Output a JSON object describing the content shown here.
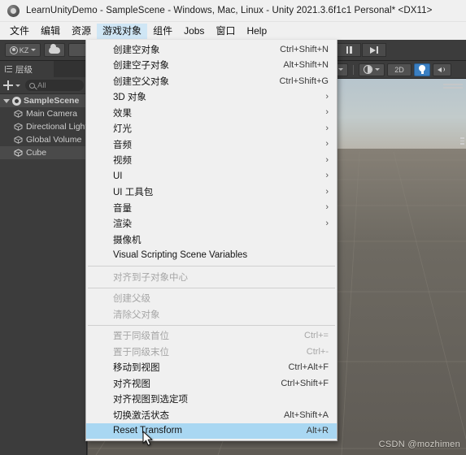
{
  "window": {
    "title": "LearnUnityDemo - SampleScene - Windows, Mac, Linux - Unity 2021.3.6f1c1 Personal* <DX11>",
    "icon": "unity-logo-icon"
  },
  "menubar": {
    "items": [
      {
        "label": "文件",
        "active": false
      },
      {
        "label": "编辑",
        "active": false
      },
      {
        "label": "资源",
        "active": false
      },
      {
        "label": "游戏对象",
        "active": true
      },
      {
        "label": "组件",
        "active": false
      },
      {
        "label": "Jobs",
        "active": false
      },
      {
        "label": "窗口",
        "active": false
      },
      {
        "label": "Help",
        "active": false
      }
    ]
  },
  "toolbar": {
    "account_label": "KZ",
    "account_icon": "user-avatar-icon",
    "cloud_icon": "cloud-icon",
    "pause_icon": "pause-icon",
    "step_icon": "step-forward-icon"
  },
  "hierarchy": {
    "tab_label": "层级",
    "tab_icon": "hierarchy-icon",
    "add_icon": "plus-icon",
    "search_icon": "search-icon",
    "search_placeholder": "All",
    "search_value": "",
    "items": [
      {
        "label": "SampleScene",
        "depth": 0,
        "icon": "scene-icon",
        "expanded": true,
        "selected": false
      },
      {
        "label": "Main Camera",
        "depth": 1,
        "icon": "cube-icon",
        "selected": false
      },
      {
        "label": "Directional Light",
        "depth": 1,
        "icon": "cube-icon",
        "selected": false
      },
      {
        "label": "Global Volume",
        "depth": 1,
        "icon": "cube-icon",
        "selected": false
      },
      {
        "label": "Cube",
        "depth": 1,
        "icon": "cube-icon",
        "selected": true
      }
    ]
  },
  "scene_toolbar": {
    "dropdown_icon": "chevron-down-icon",
    "shading_icon": "shading-mode-icon",
    "shading_caret_icon": "chevron-down-icon",
    "two_d_label": "2D",
    "lighting_icon": "lightbulb-icon",
    "audio_icon": "audio-icon"
  },
  "scene": {
    "sun_gizmo_icon": "directional-light-gizmo-icon",
    "selected_object_outline_color": "#ff7a1a",
    "axis_y_color": "#5ef23c",
    "axis_z_color": "#2158f0",
    "axis_x_color": "#f02b2b",
    "watermark": "CSDN @mozhimen"
  },
  "dropdown_menu": {
    "name": "游戏对象",
    "items": [
      {
        "label": "创建空对象",
        "shortcut": "Ctrl+Shift+N",
        "submenu": false,
        "enabled": true,
        "selected": false
      },
      {
        "label": "创建空子对象",
        "shortcut": "Alt+Shift+N",
        "submenu": false,
        "enabled": true,
        "selected": false
      },
      {
        "label": "创建空父对象",
        "shortcut": "Ctrl+Shift+G",
        "submenu": false,
        "enabled": true,
        "selected": false
      },
      {
        "label": "3D 对象",
        "shortcut": "",
        "submenu": true,
        "enabled": true,
        "selected": false
      },
      {
        "label": "效果",
        "shortcut": "",
        "submenu": true,
        "enabled": true,
        "selected": false
      },
      {
        "label": "灯光",
        "shortcut": "",
        "submenu": true,
        "enabled": true,
        "selected": false
      },
      {
        "label": "音频",
        "shortcut": "",
        "submenu": true,
        "enabled": true,
        "selected": false
      },
      {
        "label": "视频",
        "shortcut": "",
        "submenu": true,
        "enabled": true,
        "selected": false
      },
      {
        "label": "UI",
        "shortcut": "",
        "submenu": true,
        "enabled": true,
        "selected": false
      },
      {
        "label": "UI 工具包",
        "shortcut": "",
        "submenu": true,
        "enabled": true,
        "selected": false
      },
      {
        "label": "音量",
        "shortcut": "",
        "submenu": true,
        "enabled": true,
        "selected": false
      },
      {
        "label": "渲染",
        "shortcut": "",
        "submenu": true,
        "enabled": true,
        "selected": false
      },
      {
        "label": "摄像机",
        "shortcut": "",
        "submenu": false,
        "enabled": true,
        "selected": false
      },
      {
        "label": "Visual Scripting Scene Variables",
        "shortcut": "",
        "submenu": false,
        "enabled": true,
        "selected": false
      },
      {
        "separator": true
      },
      {
        "label": "对齐到子对象中心",
        "shortcut": "",
        "submenu": false,
        "enabled": false,
        "selected": false
      },
      {
        "separator": true
      },
      {
        "label": "创建父级",
        "shortcut": "",
        "submenu": false,
        "enabled": false,
        "selected": false
      },
      {
        "label": "清除父对象",
        "shortcut": "",
        "submenu": false,
        "enabled": false,
        "selected": false
      },
      {
        "separator": true
      },
      {
        "label": "置于同级首位",
        "shortcut": "Ctrl+=",
        "submenu": false,
        "enabled": false,
        "selected": false
      },
      {
        "label": "置于同级末位",
        "shortcut": "Ctrl+-",
        "submenu": false,
        "enabled": false,
        "selected": false
      },
      {
        "label": "移动到视图",
        "shortcut": "Ctrl+Alt+F",
        "submenu": false,
        "enabled": true,
        "selected": false
      },
      {
        "label": "对齐视图",
        "shortcut": "Ctrl+Shift+F",
        "submenu": false,
        "enabled": true,
        "selected": false
      },
      {
        "label": "对齐视图到选定项",
        "shortcut": "",
        "submenu": false,
        "enabled": true,
        "selected": false
      },
      {
        "label": "切换激活状态",
        "shortcut": "Alt+Shift+A",
        "submenu": false,
        "enabled": true,
        "selected": false
      },
      {
        "label": "Reset Transform",
        "shortcut": "Alt+R",
        "submenu": false,
        "enabled": true,
        "selected": true
      }
    ]
  }
}
